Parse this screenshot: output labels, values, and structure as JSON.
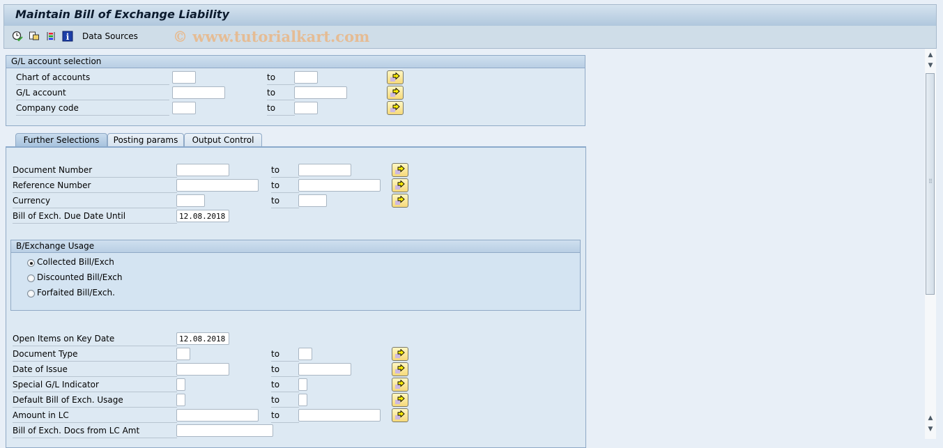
{
  "window": {
    "title": "Maintain Bill of Exchange Liability"
  },
  "toolbar": {
    "icons": [
      "execute-icon",
      "save-variant-icon",
      "selection-options-icon",
      "info-icon"
    ],
    "data_sources_label": "Data Sources",
    "watermark": "© www.tutorialkart.com"
  },
  "gl_selection": {
    "title": "G/L account selection",
    "rows": [
      {
        "label": "Chart of accounts",
        "from": "",
        "to_label": "to",
        "to": ""
      },
      {
        "label": "G/L account",
        "from": "",
        "to_label": "to",
        "to": ""
      },
      {
        "label": "Company code",
        "from": "",
        "to_label": "to",
        "to": ""
      }
    ]
  },
  "tabs": [
    {
      "label": "Further Selections",
      "active": true
    },
    {
      "label": "Posting params",
      "active": false
    },
    {
      "label": "Output Control",
      "active": false
    }
  ],
  "further": {
    "rows1": [
      {
        "label": "Document Number",
        "from": "",
        "to_label": "to",
        "to": ""
      },
      {
        "label": "Reference Number",
        "from": "",
        "to_label": "to",
        "to": ""
      },
      {
        "label": "Currency",
        "from": "",
        "to_label": "to",
        "to": ""
      }
    ],
    "due_date": {
      "label": "Bill of Exch. Due Date Until",
      "value": "12.08.2018"
    },
    "usage_group": {
      "title": "B/Exchange Usage",
      "options": [
        {
          "label": "Collected Bill/Exch",
          "selected": true
        },
        {
          "label": "Discounted Bill/Exch",
          "selected": false
        },
        {
          "label": "Forfaited Bill/Exch.",
          "selected": false
        }
      ]
    },
    "key_date": {
      "label": "Open Items on Key Date",
      "value": "12.08.2018"
    },
    "rows2": [
      {
        "label": "Document Type",
        "from": "",
        "to_label": "to",
        "to": ""
      },
      {
        "label": "Date of Issue",
        "from": "",
        "to_label": "to",
        "to": ""
      },
      {
        "label": "Special G/L Indicator",
        "from": "",
        "to_label": "to",
        "to": ""
      },
      {
        "label": "Default Bill of Exch. Usage",
        "from": "",
        "to_label": "to",
        "to": ""
      },
      {
        "label": "Amount in LC",
        "from": "",
        "to_label": "to",
        "to": ""
      }
    ],
    "lc_amt": {
      "label": "Bill of Exch. Docs from LC Amt",
      "value": ""
    }
  }
}
